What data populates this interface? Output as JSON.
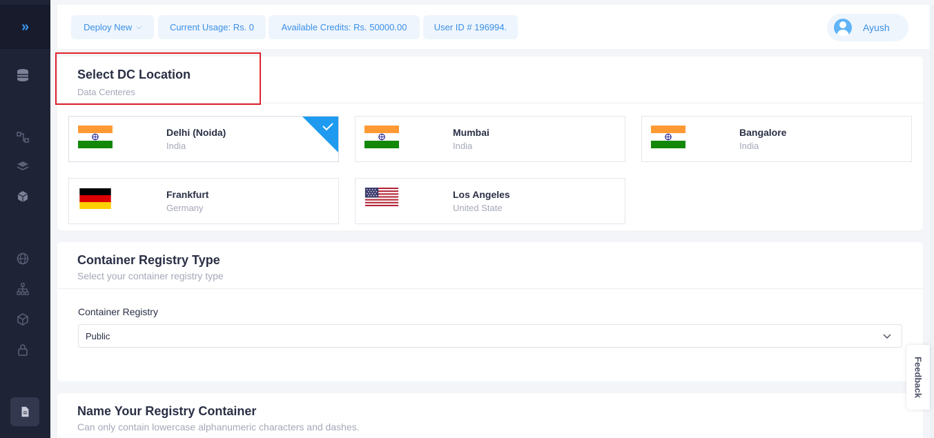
{
  "topbar": {
    "deploy_label": "Deploy New",
    "usage_label": "Current Usage: Rs. 0",
    "credits_label": "Available Credits: Rs. 50000.00",
    "userid_label": "User ID # 196994.",
    "user_name": "Ayush"
  },
  "dc_section": {
    "title": "Select DC Location",
    "subtitle": "Data Centeres",
    "locations": [
      {
        "city": "Delhi (Noida)",
        "country": "India",
        "flag": "india-flag",
        "selected": true
      },
      {
        "city": "Mumbai",
        "country": "India",
        "flag": "india-flag",
        "selected": false
      },
      {
        "city": "Bangalore",
        "country": "India",
        "flag": "india-flag",
        "selected": false
      },
      {
        "city": "Frankfurt",
        "country": "Germany",
        "flag": "germany-flag",
        "selected": false
      },
      {
        "city": "Los Angeles",
        "country": "United State",
        "flag": "usa-flag",
        "selected": false
      }
    ]
  },
  "registry_section": {
    "title": "Container Registry Type",
    "subtitle": "Select your container registry type",
    "field_label": "Container Registry",
    "selected_value": "Public"
  },
  "name_section": {
    "title": "Name Your Registry Container",
    "subtitle": "Can only contain lowercase alphanumeric characters and dashes."
  },
  "feedback_label": "Feedback",
  "colors": {
    "accent": "#3b9cf6",
    "highlight": "#e0202b",
    "sidebar": "#1f2336"
  }
}
